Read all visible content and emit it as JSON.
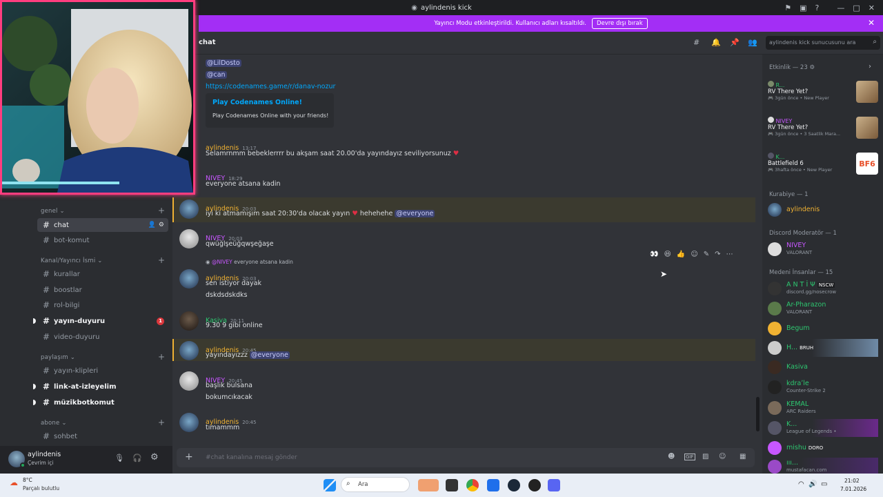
{
  "window": {
    "title": "aylindenis kick"
  },
  "banner": {
    "text": "Yayıncı Modu etkinleştirildi. Kullanıcı adları kısaltıldı.",
    "button": "Devre dışı bırak"
  },
  "channel_header": {
    "name": "chat",
    "search_placeholder": "aylindenis kick sunucusunu ara"
  },
  "sidebar": {
    "categories": [
      {
        "label": "genel"
      },
      {
        "label": "Kanal/Yayıncı İsmi"
      },
      {
        "label": "paylaşım"
      },
      {
        "label": "abone"
      }
    ],
    "channels": [
      {
        "label": "chat"
      },
      {
        "label": "bot-komut"
      },
      {
        "label": "kurallar"
      },
      {
        "label": "boostlar"
      },
      {
        "label": "rol-bilgi"
      },
      {
        "label": "yayın-duyuru",
        "badge": "1"
      },
      {
        "label": "video-duyuru"
      },
      {
        "label": "yayın-klipleri"
      },
      {
        "label": "link-at-izleyelim"
      },
      {
        "label": "müzikbotkomut"
      },
      {
        "label": "sohbet"
      }
    ]
  },
  "user_panel": {
    "name": "aylindenis",
    "status": "Çevrim içi"
  },
  "messages": {
    "m0_line1": "@LilDosto",
    "m0_line2": "@can",
    "m0_link": "https://codenames.game/r/danav-nozur",
    "embed_title": "Play Codenames Online!",
    "embed_desc": "Play Codenames Online with your friends!",
    "m1_name": "aylindenis",
    "m1_time": "13:17",
    "m1_text": "Selamrnmm bebeklerrrr bu akşam saat 20.00'da yayındayız seviliyorsunuz",
    "m2_name": "NIVEY",
    "m2_time": "18:29",
    "m2_text": "everyone atsana kadin",
    "m3_name": "aylindenis",
    "m3_time": "20:03",
    "m3_text_a": "iyi ki atmamışım saat 20:30'da olacak yayın",
    "m3_text_b": "hehehehe",
    "m3_mention": "@everyone",
    "m4_name": "NIVEY",
    "m4_time": "20:03",
    "m4_text": "qwüğlşeüğqwşeğaşe",
    "m5_reply_name": "@NIVEY",
    "m5_reply_text": "everyone atsana kadin",
    "m5_name": "aylindenis",
    "m5_time": "20:03",
    "m5_text1": "sen istiyor dayak",
    "m5_text2": "dskdsdskdks",
    "m6_name": "Kasiva",
    "m6_time": "20:11",
    "m6_text": "9.30 9 gibi online",
    "m7_name": "aylindenis",
    "m7_time": "20:45",
    "m7_text": "yayındayızzz",
    "m7_mention": "@everyone",
    "m8_name": "NIVEY",
    "m8_time": "20:45",
    "m8_text1": "başlık bulsana",
    "m8_text2": "bokumcıkacak",
    "m9_name": "aylindenis",
    "m9_time": "20:45",
    "m9_text": "tımammm"
  },
  "input": {
    "placeholder": "#chat kanalına mesaj gönder"
  },
  "members": {
    "activity_header": "Etkinlik — 23",
    "activities": [
      {
        "who": "R...",
        "game": "RV There Yet?",
        "meta": "3gün önce",
        "tag": "New Player"
      },
      {
        "who": "NIVEY",
        "game": "RV There Yet?",
        "meta": "3gün önce",
        "tag": "3 Saatlik Mara..."
      },
      {
        "who": "K...",
        "game": "Battlefield 6",
        "meta": "3hafta önce",
        "tag": "New Player"
      }
    ],
    "group1": "Kurabiye — 1",
    "g1_members": [
      {
        "name": "aylindenis"
      }
    ],
    "group2": "Discord Moderatör — 1",
    "g2_members": [
      {
        "name": "NIVEY",
        "status": "VALORANT"
      }
    ],
    "group3": "Medeni İnsanlar — 15",
    "g3_members": [
      {
        "name": "A N T İ Ψ",
        "tag": "NSCW",
        "status": "discord.gg/nosecrow"
      },
      {
        "name": "Ar-Pharazon",
        "status": "VALORANT"
      },
      {
        "name": "Begum"
      },
      {
        "name": "H...",
        "tag": "BRUH"
      },
      {
        "name": "Kasiva"
      },
      {
        "name": "kdraʼle",
        "status": "Counter-Strike 2"
      },
      {
        "name": "KEMAL",
        "status": "ARC Raiders"
      },
      {
        "name": "K...",
        "status": "League of Legends •"
      },
      {
        "name": "mishu",
        "tag": "DORO"
      },
      {
        "name": "ııı...",
        "status": "mustafacan.com"
      }
    ]
  },
  "taskbar": {
    "weather_temp": "8°C",
    "weather_desc": "Parçalı bulutlu",
    "search": "Ara",
    "time": "21:02",
    "date": "7.01.2026"
  },
  "colors": {
    "accent": "#a32ef5",
    "mod_name": "#c757ff",
    "owner_name": "#f0b232",
    "member_name": "#2dc770",
    "mention_bg": "#3c4270"
  }
}
